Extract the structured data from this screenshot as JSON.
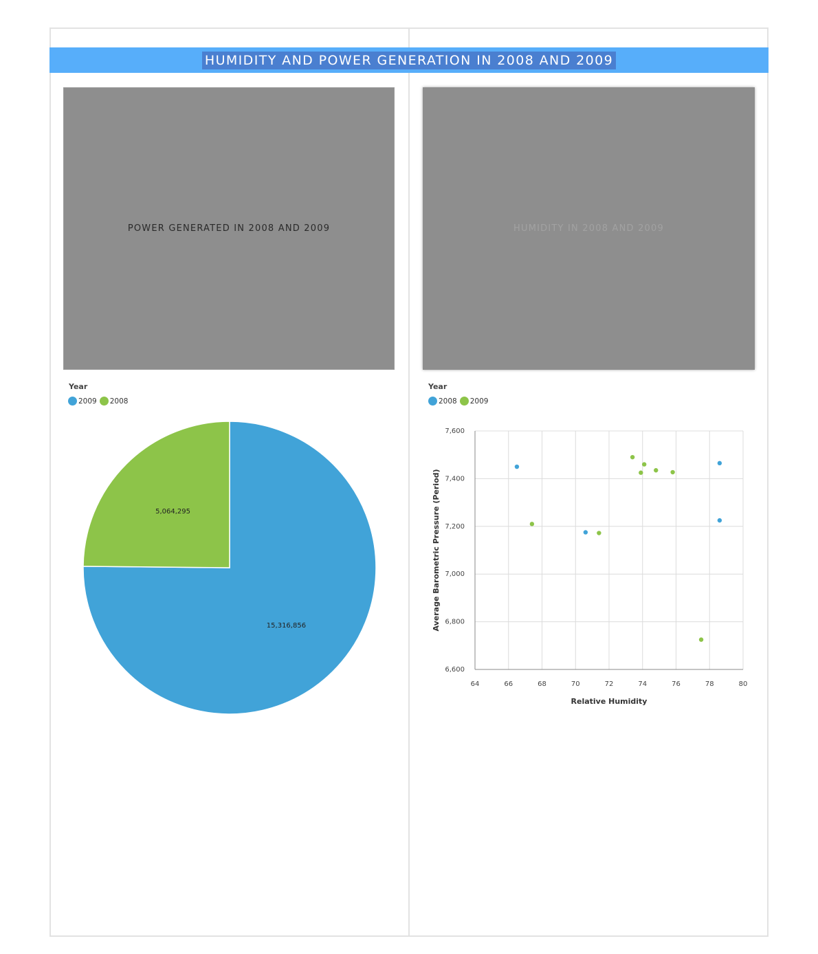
{
  "page": {
    "title": "HUMIDITY AND POWER GENERATION IN 2008 AND 2009"
  },
  "left_panel": {
    "image_caption": "POWER GENERATED IN 2008 AND 2009",
    "legend_title": "Year",
    "legend": [
      {
        "label": "2009",
        "color": "#41a3d8"
      },
      {
        "label": "2008",
        "color": "#8dc449"
      }
    ]
  },
  "right_panel": {
    "image_caption": "HUMIDITY IN 2008 AND 2009",
    "legend_title": "Year",
    "legend": [
      {
        "label": "2008",
        "color": "#41a3d8"
      },
      {
        "label": "2009",
        "color": "#8dc449"
      }
    ]
  },
  "chart_data": [
    {
      "type": "pie",
      "legend_title": "Year",
      "legend_position": "top-left",
      "categories": [
        "2009",
        "2008"
      ],
      "values": [
        15316856,
        5064295
      ],
      "value_labels": [
        "15,316,856",
        "5,064,295"
      ],
      "colors": [
        "#41a3d8",
        "#8dc449"
      ]
    },
    {
      "type": "scatter",
      "legend_title": "Year",
      "legend_position": "top-left",
      "xlabel": "Relative Humidity",
      "ylabel": "Average Barometric Pressure (Period)",
      "xlim": [
        64,
        80
      ],
      "ylim": [
        6600,
        7600
      ],
      "xticks": [
        "64",
        "66",
        "68",
        "70",
        "72",
        "74",
        "76",
        "78",
        "80"
      ],
      "yticks": [
        "6,600",
        "6,800",
        "7,000",
        "7,200",
        "7,400",
        "7,600"
      ],
      "grid": true,
      "series": [
        {
          "name": "2008",
          "color": "#41a3d8",
          "points": [
            [
              66.5,
              7450
            ],
            [
              70.6,
              7175
            ],
            [
              78.6,
              7465
            ],
            [
              78.6,
              7225
            ]
          ]
        },
        {
          "name": "2009",
          "color": "#8dc449",
          "points": [
            [
              67.4,
              7210
            ],
            [
              71.4,
              7172
            ],
            [
              73.4,
              7490
            ],
            [
              73.9,
              7425
            ],
            [
              74.1,
              7460
            ],
            [
              74.8,
              7435
            ],
            [
              75.8,
              7427
            ],
            [
              77.5,
              6725
            ]
          ]
        }
      ]
    }
  ]
}
